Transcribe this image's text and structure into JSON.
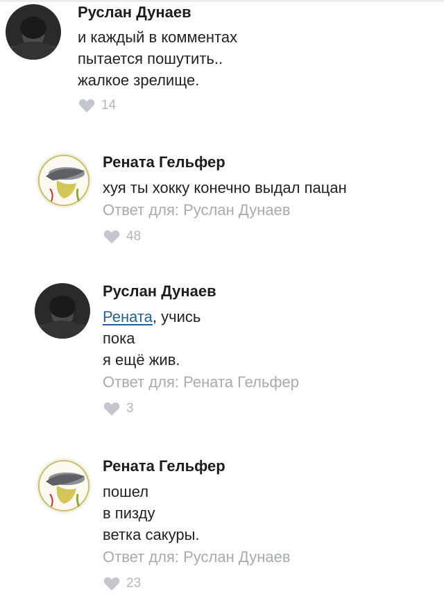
{
  "comments": [
    {
      "author": "Руслан Дунаев",
      "avatar": "ruslan-avatar",
      "lines": [
        "и каждый в комментах",
        "пытается пошутить..",
        "жалкое зрелище."
      ],
      "likes": "14"
    },
    {
      "author": "Рената Гельфер",
      "avatar": "renata-avatar",
      "lines": [
        "хуя ты хокку конечно выдал пацан"
      ],
      "reply_to": "Ответ для: Руслан Дунаев",
      "likes": "48"
    },
    {
      "author": "Руслан Дунаев",
      "avatar": "ruslan-avatar",
      "mention": "Рената",
      "first_line_rest": ", учись",
      "lines": [
        "пока",
        "я ещё жив."
      ],
      "reply_to": "Ответ для: Рената Гельфер",
      "likes": "3"
    },
    {
      "author": "Рената Гельфер",
      "avatar": "renata-avatar",
      "lines": [
        "пошел",
        "в пизду",
        "ветка сакуры."
      ],
      "reply_to": "Ответ для: Руслан Дунаев",
      "likes": "23"
    }
  ],
  "icons": {
    "like": "heart-icon"
  },
  "colors": {
    "link": "#2b5e92",
    "muted": "#a7abb0"
  }
}
